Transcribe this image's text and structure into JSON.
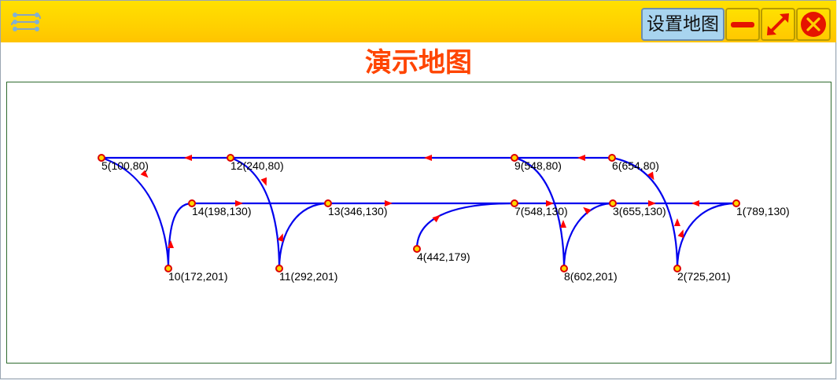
{
  "window": {
    "app_icon": "route-map-icon",
    "set_map_label": "设置地图",
    "minimize_icon": "minimize-icon",
    "maximize_icon": "maximize-icon",
    "close_icon": "close-icon"
  },
  "heading": "演示地图",
  "map": {
    "colors": {
      "path": "#0000ee",
      "arrow": "#ff0000",
      "node_fill": "#ffd700",
      "node_stroke": "#dd0000"
    },
    "nodes": [
      {
        "id": 1,
        "label": "1(789,130)"
      },
      {
        "id": 2,
        "label": "2(725,201)"
      },
      {
        "id": 3,
        "label": "3(655,130)"
      },
      {
        "id": 4,
        "label": "4(442,179)"
      },
      {
        "id": 5,
        "label": "5(100,80)"
      },
      {
        "id": 6,
        "label": "6(654,80)"
      },
      {
        "id": 7,
        "label": "7(548,130)"
      },
      {
        "id": 8,
        "label": "8(602,201)"
      },
      {
        "id": 9,
        "label": "9(548,80)"
      },
      {
        "id": 10,
        "label": "10(172,201)"
      },
      {
        "id": 11,
        "label": "11(292,201)"
      },
      {
        "id": 12,
        "label": "12(240,80)"
      },
      {
        "id": 13,
        "label": "13(346,130)"
      },
      {
        "id": 14,
        "label": "14(198,130)"
      }
    ]
  }
}
